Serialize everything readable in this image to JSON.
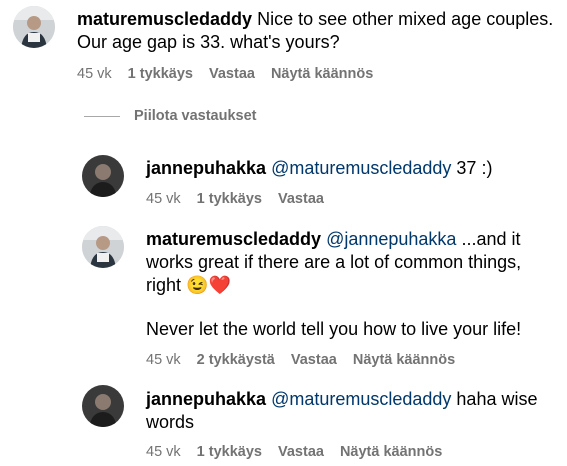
{
  "comments": [
    {
      "user": "maturemuscledaddy",
      "text": "Nice to see other mixed age couples. Our age gap is 33. what's yours?",
      "time": "45 vk",
      "likes": "1 tykkäys",
      "reply": "Vastaa",
      "translate": "Näytä käännös"
    }
  ],
  "hide_replies": "Piilota vastaukset",
  "replies": [
    {
      "user": "jannepuhakka",
      "mention": "@maturemuscledaddy",
      "text": " 37 :)",
      "time": "45 vk",
      "likes": "1 tykkäys",
      "reply": "Vastaa"
    },
    {
      "user": "maturemuscledaddy",
      "mention": "@jannepuhakka",
      "text": " ...and it works great if there are a lot of common things, right",
      "emoji1": "😉",
      "emoji2": "❤️",
      "text2": "Never let the world tell you how to live your life!",
      "time": "45 vk",
      "likes": "2 tykkäystä",
      "reply": "Vastaa",
      "translate": "Näytä käännös"
    },
    {
      "user": "jannepuhakka",
      "mention": "@maturemuscledaddy",
      "text": " haha wise words",
      "time": "45 vk",
      "likes": "1 tykkäys",
      "reply": "Vastaa",
      "translate": "Näytä käännös"
    }
  ]
}
